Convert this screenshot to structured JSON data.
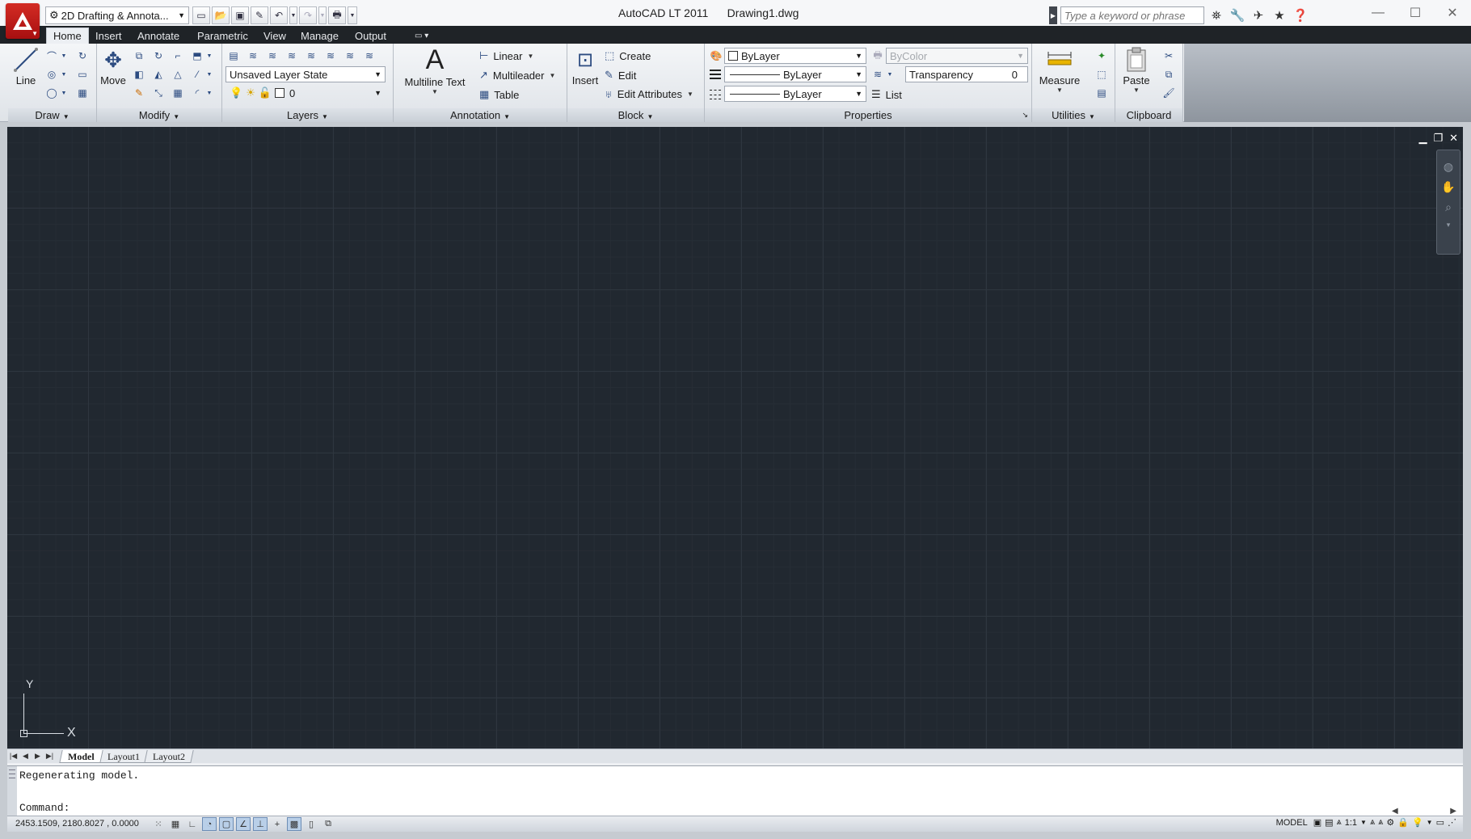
{
  "titlebar": {
    "app_name": "AutoCAD LT 2011",
    "document": "Drawing1.dwg",
    "workspace": "2D Drafting & Annota...",
    "search_placeholder": "Type a keyword or phrase"
  },
  "tabs": [
    "Home",
    "Insert",
    "Annotate",
    "Parametric",
    "View",
    "Manage",
    "Output"
  ],
  "active_tab": "Home",
  "panels": {
    "draw": {
      "title": "Draw",
      "line_label": "Line"
    },
    "modify": {
      "title": "Modify",
      "move_label": "Move"
    },
    "layers": {
      "title": "Layers",
      "layer_state": "Unsaved Layer State",
      "current_layer": "0"
    },
    "annotation": {
      "title": "Annotation",
      "multiline_text": "Multiline Text",
      "linear": "Linear",
      "multileader": "Multileader",
      "table": "Table"
    },
    "block": {
      "title": "Block",
      "insert": "Insert",
      "create": "Create",
      "edit": "Edit",
      "edit_attributes": "Edit Attributes"
    },
    "properties": {
      "title": "Properties",
      "color": "ByLayer",
      "lineweight": "ByLayer",
      "linetype": "ByLayer",
      "plotstyle": "ByColor",
      "transparency_label": "Transparency",
      "transparency_value": "0",
      "list": "List"
    },
    "utilities": {
      "title": "Utilities",
      "measure": "Measure"
    },
    "clipboard": {
      "title": "Clipboard",
      "paste": "Paste"
    }
  },
  "canvas": {
    "ucs_x": "X",
    "ucs_y": "Y"
  },
  "layout_tabs": [
    "Model",
    "Layout1",
    "Layout2"
  ],
  "active_layout": "Model",
  "command": {
    "history": "Regenerating model.",
    "prompt": "Command:"
  },
  "status": {
    "coordinates": "2453.1509, 2180.8027 , 0.0000",
    "space": "MODEL",
    "scale": "1:1"
  },
  "colors": {
    "canvas_bg": "#212830",
    "tab_bar": "#1f2327",
    "app_button": "#c31e1a"
  }
}
